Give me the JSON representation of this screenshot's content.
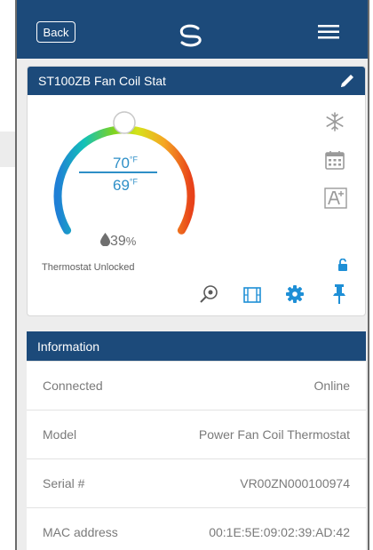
{
  "header": {
    "back_label": "Back",
    "logo_icon": "brand-swirl-logo",
    "menu_icon": "hamburger-menu-icon",
    "bg_color": "#1c4a7a"
  },
  "device": {
    "title": "ST100ZB Fan Coil Stat",
    "setpoint": "70",
    "setpoint_unit": "°F",
    "current_temp": "69",
    "current_unit": "°F",
    "humidity_value": "39",
    "humidity_unit": "%",
    "lock_status": "Thermostat Unlocked",
    "mode_icons": [
      "snowflake-icon",
      "calendar-icon",
      "font-size-icon"
    ],
    "action_icons": [
      "view-icon",
      "film-icon",
      "settings-gear-icon",
      "pin-icon"
    ],
    "accent_color": "#2e8fc7",
    "setpoint_fraction": 0.5
  },
  "info": {
    "title": "Information",
    "rows": [
      {
        "label": "Connected",
        "value": "Online"
      },
      {
        "label": "Model",
        "value": "Power Fan Coil Thermostat"
      },
      {
        "label": "Serial #",
        "value": "VR00ZN000100974"
      },
      {
        "label": "MAC address",
        "value": "00:1E:5E:09:02:39:AD:42"
      }
    ]
  }
}
